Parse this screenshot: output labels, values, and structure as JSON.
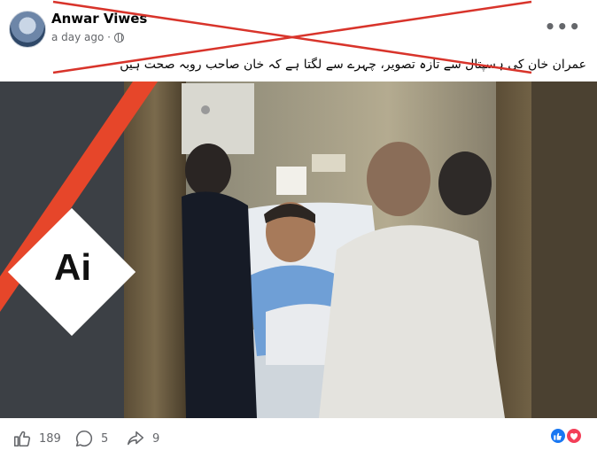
{
  "post": {
    "author": "Anwar Viwes",
    "time": "a day ago ·",
    "more_icon": "more-horizontal-icon",
    "caption": "عمران خان کی ہسپتال سے تازہ تصویر، چہرے سے لگتا ہے کہ خان صاحب روبہ صحت ہیں",
    "overlay_badge": "Ai"
  },
  "stats": {
    "likes": "189",
    "comments": "5",
    "shares": "9"
  },
  "colors": {
    "x_mark": "#d8342b",
    "badge_stripe": "#e6462a",
    "like_blue": "#1877f2",
    "love_red": "#f33e58"
  }
}
